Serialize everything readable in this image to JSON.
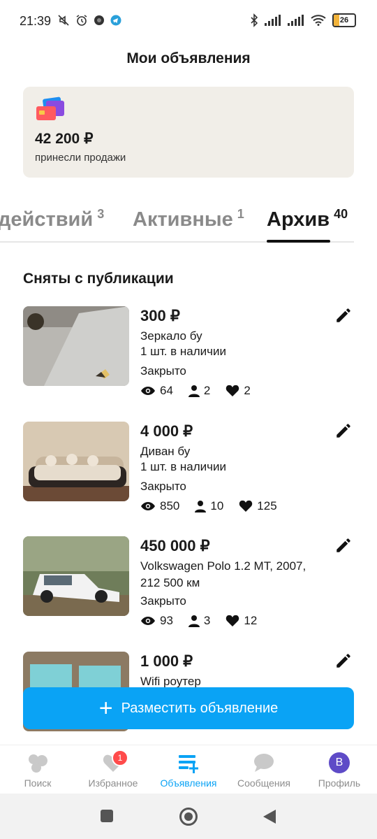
{
  "status_bar": {
    "time": "21:39",
    "battery": "26",
    "battery_level": 0.26
  },
  "header": {
    "title": "Мои объявления"
  },
  "sales": {
    "amount": "42 200 ₽",
    "caption": "принесли продажи"
  },
  "tabs": [
    {
      "label": "действий",
      "count": "3"
    },
    {
      "label": "Активные",
      "count": "1"
    },
    {
      "label": "Архив",
      "count": "40",
      "active": true
    }
  ],
  "section": {
    "title": "Сняты с публикации"
  },
  "listings": [
    {
      "price": "300 ₽",
      "title": "Зеркало бу",
      "stock": "1 шт. в наличии",
      "status": "Закрыто",
      "views": "64",
      "contacts": "2",
      "favorites": "2"
    },
    {
      "price": "4 000 ₽",
      "title": "Диван бу",
      "stock": "1 шт. в наличии",
      "status": "Закрыто",
      "views": "850",
      "contacts": "10",
      "favorites": "125"
    },
    {
      "price": "450 000 ₽",
      "title": "Volkswagen Polo 1.2 MT, 2007, 212 500 км",
      "status": "Закрыто",
      "views": "93",
      "contacts": "3",
      "favorites": "12"
    },
    {
      "price": "1 000 ₽",
      "title": "Wifi роутер"
    }
  ],
  "fab": {
    "label": "Разместить объявление"
  },
  "bottom_nav": {
    "items": [
      {
        "label": "Поиск",
        "icon": "search-bubbles-icon"
      },
      {
        "label": "Избранное",
        "icon": "heart-icon",
        "badge": "1"
      },
      {
        "label": "Объявления",
        "icon": "listings-add-icon",
        "active": true
      },
      {
        "label": "Сообщения",
        "icon": "chat-icon"
      },
      {
        "label": "Профиль",
        "icon": "avatar",
        "avatar_letter": "В"
      }
    ]
  },
  "colors": {
    "accent": "#0aa3f5",
    "card_bg": "#f1eee8",
    "badge": "#ff4b4b",
    "avatar": "#5e4bc7"
  }
}
